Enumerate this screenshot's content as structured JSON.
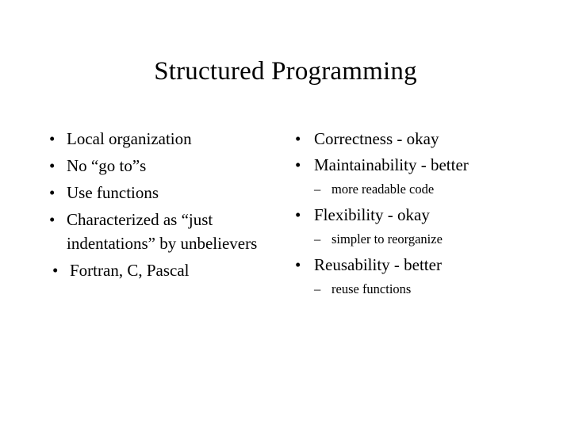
{
  "slide": {
    "title": "Structured Programming",
    "background_color": "#ffffff",
    "text_color": "#000000",
    "bullet_glyph": "•",
    "subbullet_glyph": "–",
    "left_column": {
      "items": [
        {
          "text": "Local organization",
          "subitems": []
        },
        {
          "text": "No “go to”s",
          "subitems": []
        },
        {
          "text": "Use functions",
          "subitems": []
        },
        {
          "text": "Characterized as “just indentations” by unbelievers",
          "subitems": []
        },
        {
          "text": "Fortran, C, Pascal",
          "subitems": []
        }
      ]
    },
    "right_column": {
      "items": [
        {
          "text": "Correctness - okay",
          "subitems": []
        },
        {
          "text": "Maintainability - better",
          "subitems": [
            "more readable code"
          ]
        },
        {
          "text": "Flexibility - okay",
          "subitems": [
            "simpler to reorganize"
          ]
        },
        {
          "text": "Reusability - better",
          "subitems": [
            "reuse functions"
          ]
        }
      ]
    }
  }
}
